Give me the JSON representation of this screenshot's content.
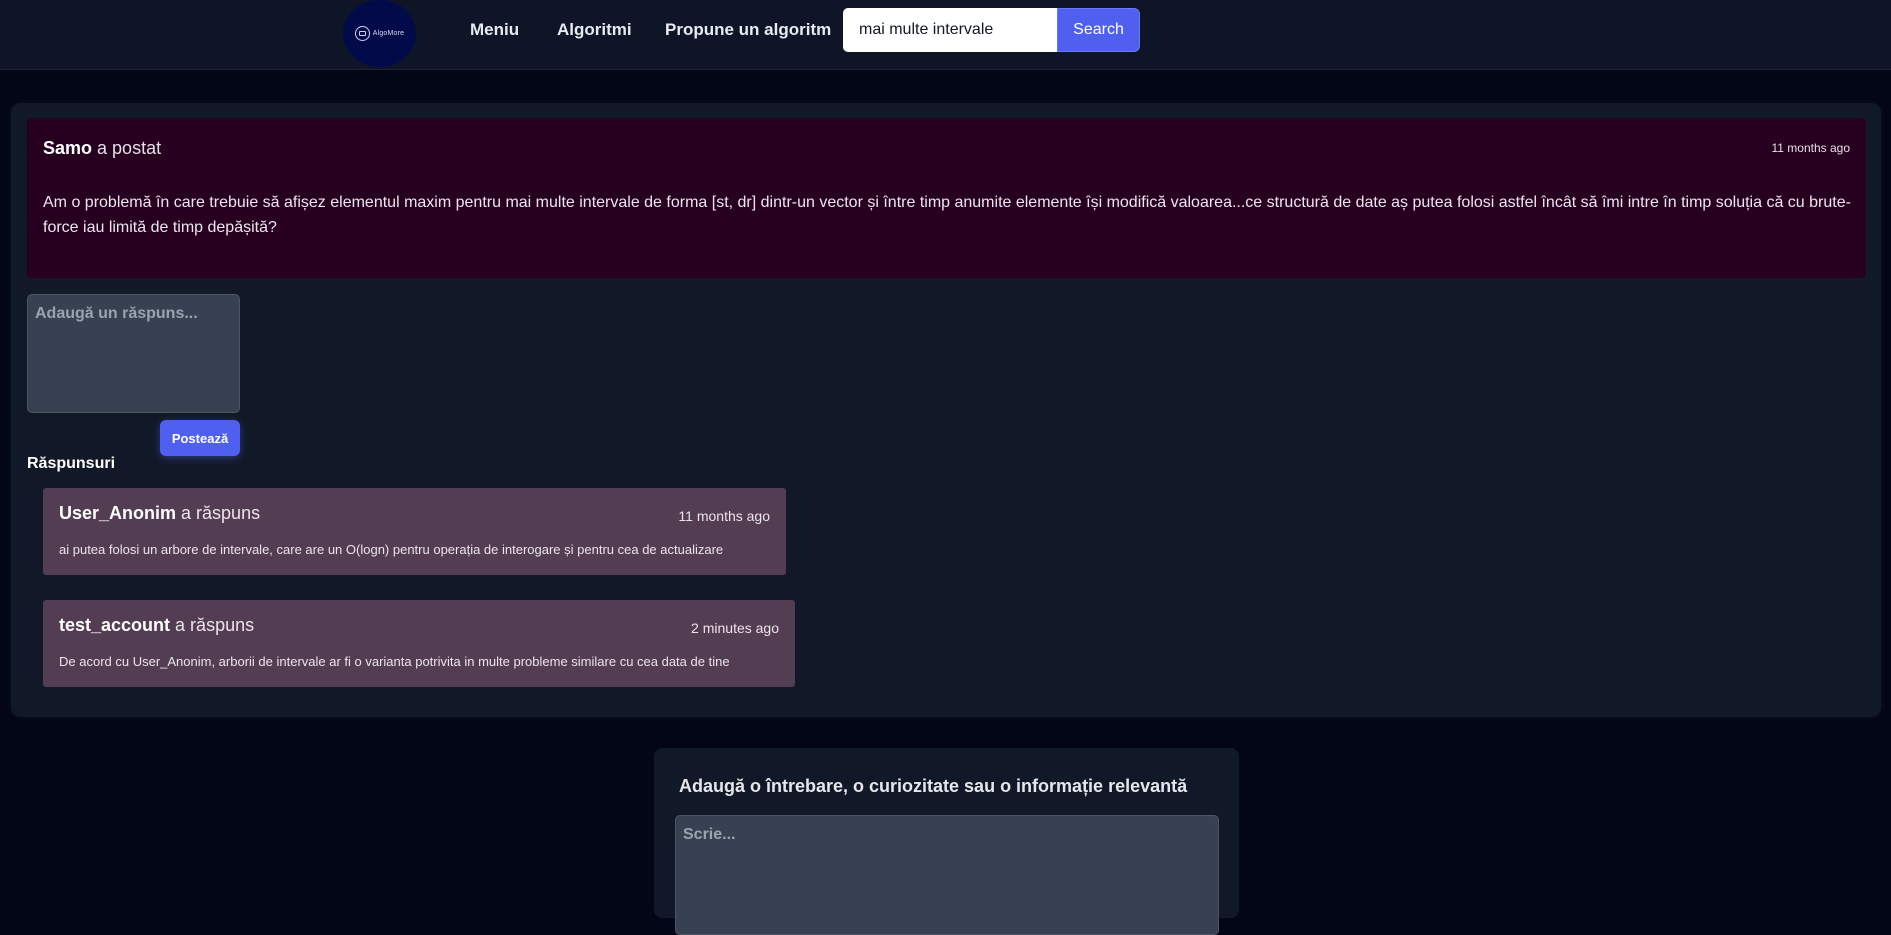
{
  "nav": {
    "logo_text": "AlgoMore",
    "links": [
      "Meniu",
      "Algoritmi",
      "Propune un algoritm"
    ],
    "search_value": "mai multe intervale",
    "search_button": "Search"
  },
  "question": {
    "author": "Samo",
    "action": " a postat",
    "time": "11 months ago",
    "body": "Am o problemă în care trebuie să afișez elementul maxim pentru mai multe intervale de forma [st, dr] dintr-un vector și între timp anumite elemente își modifică valoarea...ce structură de date aș putea folosi astfel încât să îmi intre în timp soluția că cu brute-force iau limită de timp depășită?"
  },
  "reply_form": {
    "placeholder": "Adaugă un răspuns...",
    "submit_label": "Postează"
  },
  "answers_title": "Răspunsuri",
  "answers": [
    {
      "author": "User_Anonim",
      "action": " a răspuns",
      "time": "11 months ago",
      "body": "ai putea folosi un arbore de intervale, care are un O(logn) pentru operația de interogare și pentru cea de actualizare"
    },
    {
      "author": "test_account",
      "action": " a răspuns",
      "time": "2 minutes ago",
      "body": "De acord cu User_Anonim, arborii de intervale ar fi o varianta potrivita in multe probleme similare cu cea data de tine"
    }
  ],
  "new_question": {
    "title": "Adaugă o întrebare, o curiozitate sau o informație relevantă",
    "placeholder": "Scrie..."
  },
  "colors": {
    "background": "#030616",
    "navbar": "#0e1527",
    "accent": "#4f60f0",
    "question_card": "#270020",
    "answer_card": "#533d52",
    "input_bg": "#374151"
  }
}
